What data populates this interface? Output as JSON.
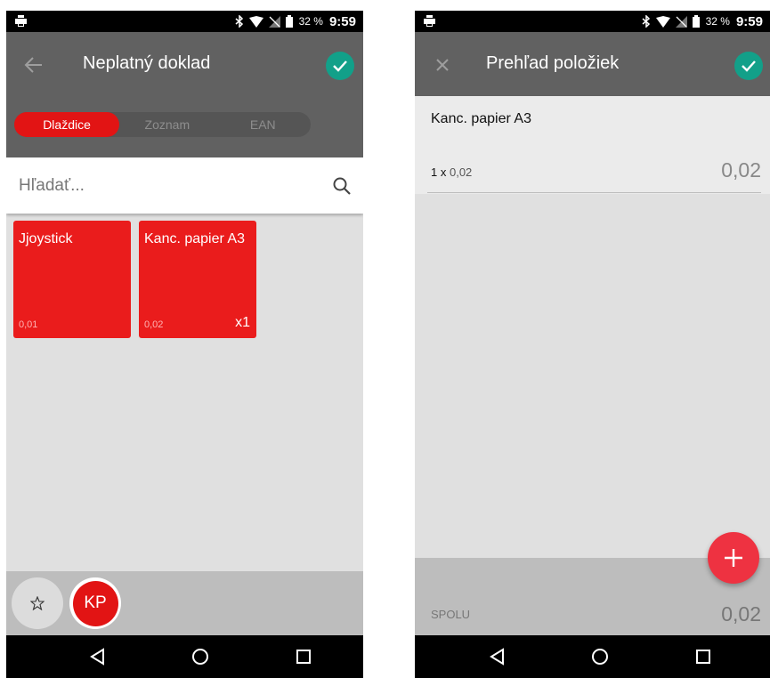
{
  "status_bar": {
    "battery_percent": "32 %",
    "time": "9:59",
    "icons": [
      "printer-icon",
      "bluetooth-icon",
      "wifi-icon",
      "no-sim-icon",
      "battery-icon"
    ]
  },
  "left_screen": {
    "title": "Neplatný doklad",
    "back_icon": "arrow-back-icon",
    "confirm_icon": "check-icon",
    "view_tabs": [
      {
        "label": "Dlaždice",
        "active": true
      },
      {
        "label": "Zoznam",
        "active": false
      },
      {
        "label": "EAN",
        "active": false
      }
    ],
    "search": {
      "placeholder": "Hľadať..."
    },
    "tiles": [
      {
        "name": "Jjoystick",
        "price": "0,01",
        "count": ""
      },
      {
        "name": "Kanc. papier A3",
        "price": "0,02",
        "count": "x1"
      }
    ],
    "bottom_bar": {
      "favorite_icon": "star-icon",
      "user_initials": "KP"
    }
  },
  "right_screen": {
    "title": "Prehľad položiek",
    "close_icon": "close-icon",
    "confirm_icon": "check-icon",
    "items": [
      {
        "name": "Kanc. papier A3",
        "quantity": "1",
        "times": "x",
        "unit_price": "0,02",
        "total": "0,02"
      }
    ],
    "sum": {
      "label": "SPOLU",
      "value": "0,02"
    },
    "fab_icon": "plus-icon"
  },
  "colors": {
    "appbar": "#616161",
    "accent_red": "#e21414",
    "tile_red": "#ea1c1c",
    "confirm_green": "#12a089",
    "fab_red": "#ee3241"
  },
  "nav_bar": {
    "icons": [
      "back-triangle-icon",
      "home-circle-icon",
      "recents-square-icon"
    ]
  }
}
